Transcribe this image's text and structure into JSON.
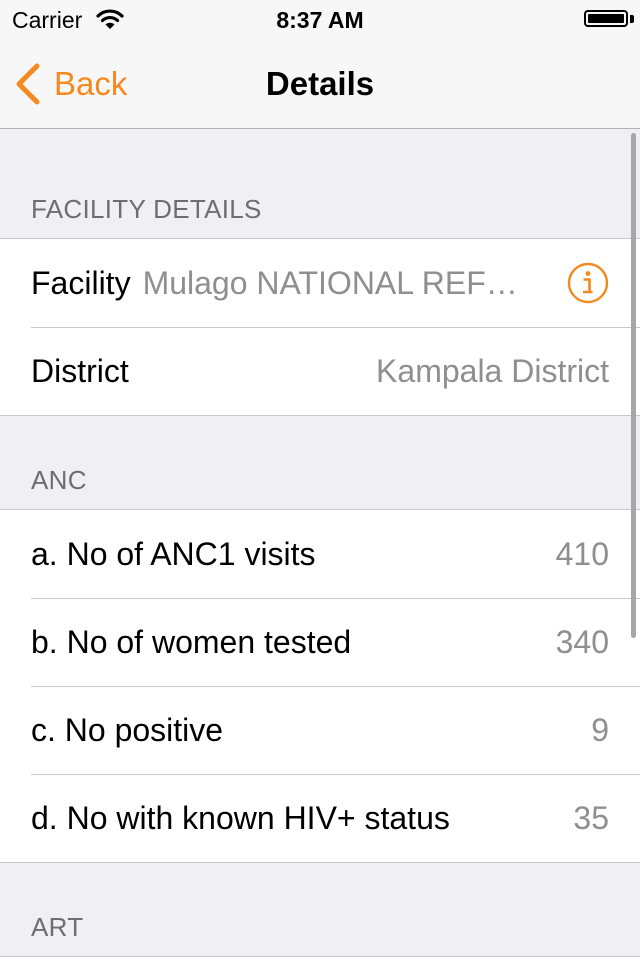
{
  "status_bar": {
    "carrier": "Carrier",
    "time": "8:37 AM",
    "icons": [
      "wifi-icon",
      "battery-icon"
    ]
  },
  "nav": {
    "back_label": "Back",
    "title": "Details"
  },
  "colors": {
    "accent": "#f5891f",
    "background": "#efeff4",
    "secondary_text": "#8e8e93",
    "section_header": "#6d6d72"
  },
  "facility_section": {
    "header": "FACILITY DETAILS",
    "facility_label": "Facility",
    "facility_value": "Mulago NATIONAL REF…",
    "district_label": "District",
    "district_value": "Kampala District"
  },
  "anc_section": {
    "header": "ANC",
    "rows": [
      {
        "label": "a. No of ANC1 visits",
        "value": "410"
      },
      {
        "label": "b. No of women tested",
        "value": "340"
      },
      {
        "label": "c. No positive",
        "value": "9"
      },
      {
        "label": "d. No with known HIV+ status",
        "value": "35"
      }
    ]
  },
  "art_section": {
    "header": "ART"
  }
}
